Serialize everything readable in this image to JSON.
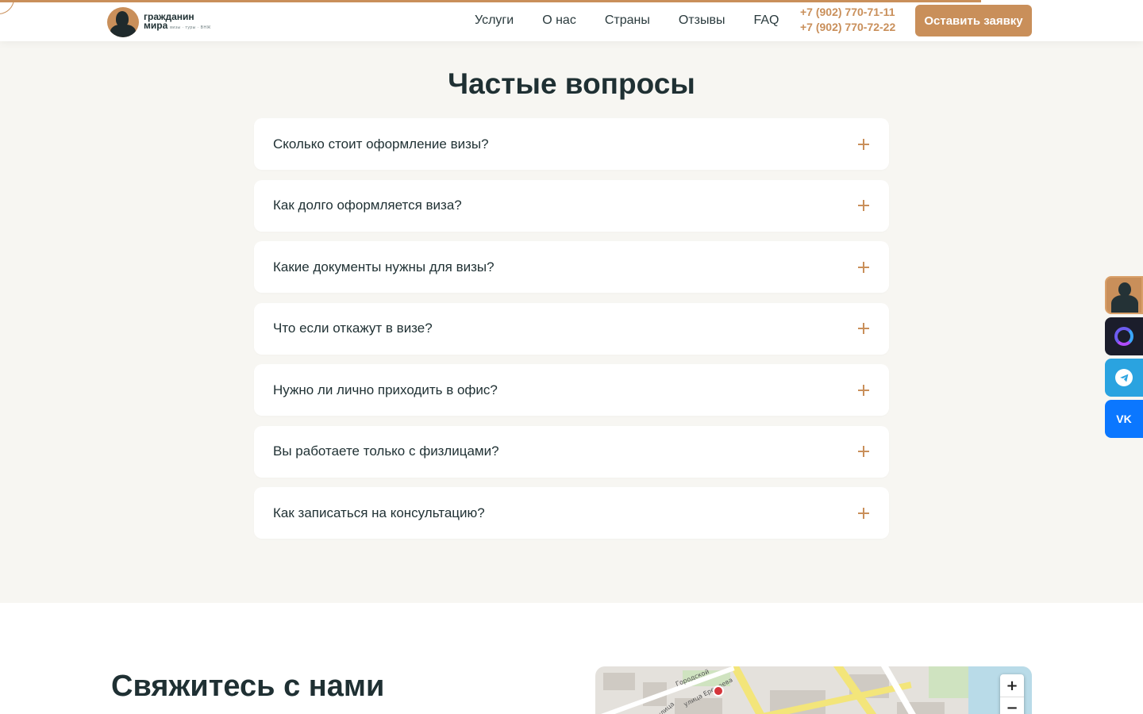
{
  "brand": {
    "line1": "гражданин",
    "line2": "мира",
    "tagline": "визы · туры · ВНЖ"
  },
  "nav": {
    "items": [
      "Услуги",
      "О нас",
      "Страны",
      "Отзывы",
      "FAQ"
    ]
  },
  "contacts": {
    "phone1": "+7 (902) 770-71-11",
    "phone2": "+7 (902) 770-72-22"
  },
  "header": {
    "cta_label": "Оставить заявку"
  },
  "faq": {
    "title": "Частые вопросы",
    "items": [
      "Сколько стоит оформление визы?",
      "Как долго оформляется виза?",
      "Какие документы нужны для визы?",
      "Что если откажут в визе?",
      "Нужно ли лично приходить в офис?",
      "Вы работаете только с физлицами?",
      "Как записаться на консультацию?"
    ]
  },
  "contact_section": {
    "title": "Свяжитесь с нами",
    "map": {
      "street1": "Городской",
      "street2": "улица Еремеева",
      "street3": "улица",
      "zoom_in": "+",
      "zoom_out": "−"
    }
  },
  "side_widgets": {
    "vk_label": "VK"
  },
  "colors": {
    "accent": "#c98f5a",
    "text": "#1f3033",
    "bg": "#f7f6f2"
  }
}
